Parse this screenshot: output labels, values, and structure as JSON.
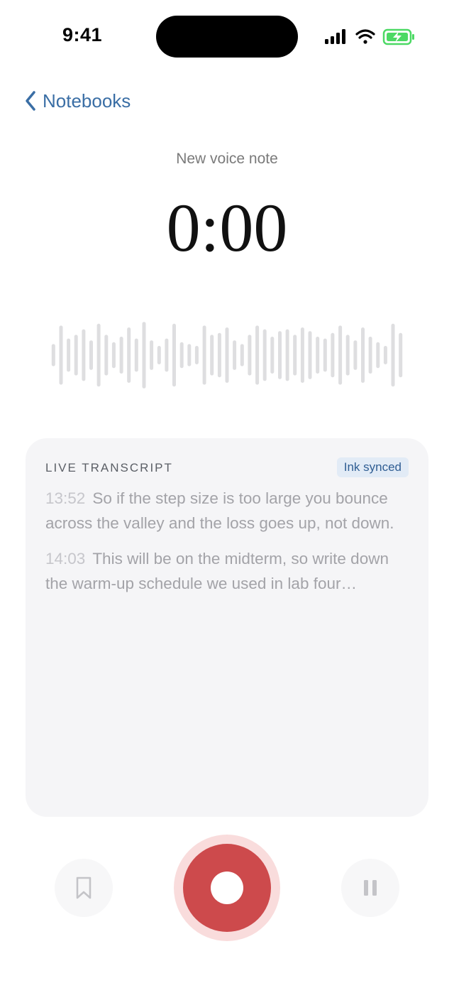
{
  "status_bar": {
    "time": "9:41",
    "icons": [
      "cellular-signal-icon",
      "wifi-icon",
      "battery-charging-icon"
    ],
    "battery_color": "#4cd964"
  },
  "nav": {
    "back_label": "Notebooks",
    "back_icon": "chevron-left-icon",
    "accent": "#3a6ea5"
  },
  "recording": {
    "title": "New voice note",
    "elapsed": "0:00"
  },
  "transcript": {
    "header": "LIVE TRANSCRIPT",
    "badge": "Ink synced",
    "entries": [
      {
        "time": "13:52",
        "text": "So if the step size is too large you bounce across the valley and the loss goes up, not down."
      },
      {
        "time": "14:03",
        "text": "This will be on the midterm, so write down the warm-up schedule we used in lab four…"
      }
    ]
  },
  "controls": {
    "bookmark_icon": "bookmark-icon",
    "record_icon": "record-icon",
    "pause_icon": "pause-icon",
    "record_color": "#cd4a4c"
  }
}
